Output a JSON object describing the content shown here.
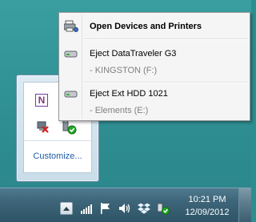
{
  "context_menu": {
    "open_devices_label": "Open Devices and Printers",
    "items": [
      {
        "label": "Eject DataTraveler G3",
        "sub": "-   KINGSTON (F:)"
      },
      {
        "label": "Eject Ext HDD 1021",
        "sub": "-   Elements (E:)"
      }
    ]
  },
  "overflow": {
    "customize_label": "Customize...",
    "icons": [
      "onenote-icon",
      "network-error-icon",
      "usb-safely-remove-icon"
    ],
    "onenote_glyph": "N"
  },
  "taskbar": {
    "time": "10:21 PM",
    "date": "12/09/2012",
    "icons": [
      "show-hidden-icons-arrow",
      "network-signal-icon",
      "action-center-flag-icon",
      "volume-icon",
      "dropbox-icon",
      "usb-safely-remove-icon"
    ]
  },
  "colors": {
    "menu_bg": "#f5f5f5",
    "taskbar": "#3d6478",
    "link": "#1e5ca8"
  }
}
